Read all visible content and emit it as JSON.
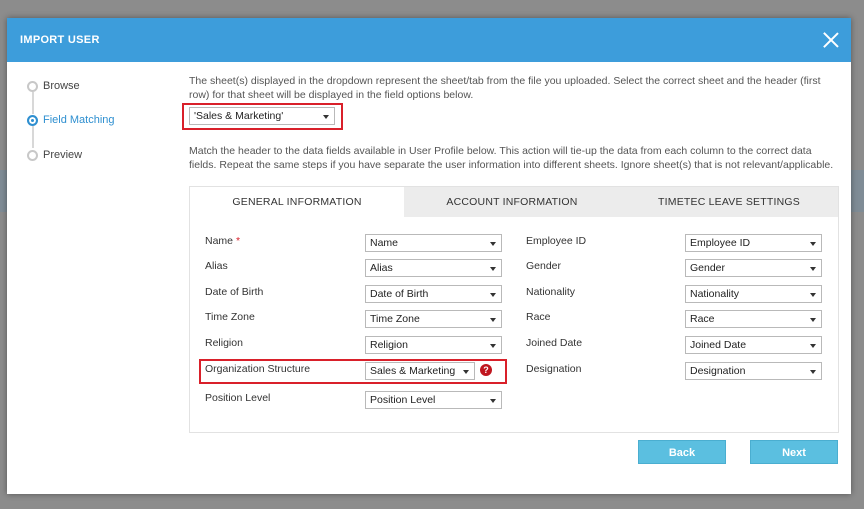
{
  "modal": {
    "title": "IMPORT USER",
    "steps": [
      {
        "label": "Browse",
        "active": false
      },
      {
        "label": "Field Matching",
        "active": true
      },
      {
        "label": "Preview",
        "active": false
      }
    ],
    "sheet_instructions": "The sheet(s) displayed in the dropdown represent the sheet/tab from the file you uploaded. Select the correct sheet and the header (first row) for that sheet will be displayed in the field options below.",
    "sheet_select_value": "'Sales & Marketing'",
    "match_instructions": "Match the header to the data fields available in User Profile below. This action will tie-up the data from each column to the correct data fields. Repeat the same steps if you have separate the user information into different sheets. Ignore sheet(s) that is not relevant/applicable.",
    "tabs": [
      "GENERAL INFORMATION",
      "ACCOUNT INFORMATION",
      "TIMETEC LEAVE SETTINGS"
    ],
    "left_fields": [
      {
        "label": "Name",
        "required_mark": "*",
        "value": "Name"
      },
      {
        "label": "Alias",
        "value": "Alias"
      },
      {
        "label": "Date of Birth",
        "value": "Date of Birth"
      },
      {
        "label": "Time Zone",
        "value": "Time Zone"
      },
      {
        "label": "Religion",
        "value": "Religion"
      },
      {
        "label": "Organization Structure",
        "value": "Sales & Marketing",
        "help": "?"
      },
      {
        "label": "Position Level",
        "value": "Position Level"
      }
    ],
    "right_fields": [
      {
        "label": "Employee ID",
        "value": "Employee ID"
      },
      {
        "label": "Gender",
        "value": "Gender"
      },
      {
        "label": "Nationality",
        "value": "Nationality"
      },
      {
        "label": "Race",
        "value": "Race"
      },
      {
        "label": "Joined Date",
        "value": "Joined Date"
      },
      {
        "label": "Designation",
        "value": "Designation"
      }
    ],
    "back_label": "Back",
    "next_label": "Next"
  },
  "colors": {
    "header": "#3d9ddb",
    "active_step": "#2e8fd0",
    "highlight": "#d9202a",
    "button": "#5bbfe0"
  }
}
